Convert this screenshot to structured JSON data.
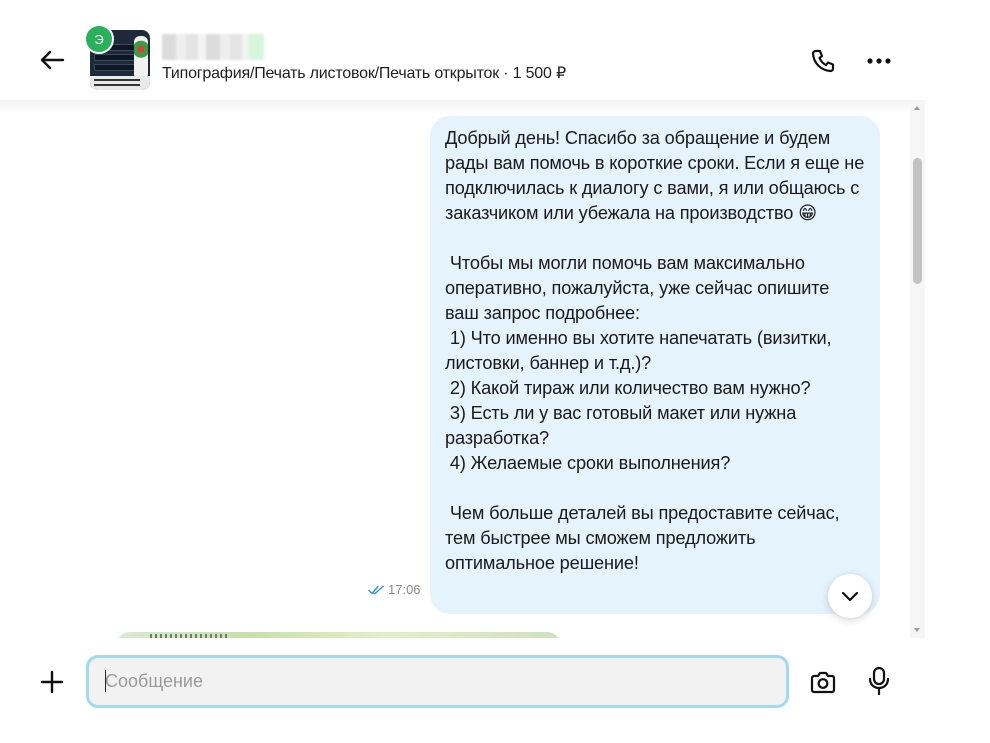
{
  "header": {
    "back_icon": "arrow-left-icon",
    "avatar_letter": "Э",
    "avatar_color": "#2ab05a",
    "listing_text": "Типография/Печать листовок/Печать открыток · 1 500 ₽",
    "call_icon": "phone-icon",
    "more_icon": "more-dots-icon"
  },
  "chat": {
    "messages": [
      {
        "direction": "outgoing",
        "text": "Добрый день! Спасибо за обращение и будем рады вам помочь в короткие сроки. Если я еще не подключилась к диалогу с вами, я или общаюсь с заказчиком или убежала на производство 😁\n\n Чтобы мы могли помочь вам максимально оперативно, пожалуйста, уже сейчас опишите ваш запрос подробнее:\n 1) Что именно вы хотите напечатать (визитки, листовки, баннер и т.д.)?\n 2) Какой тираж или количество вам нужно?\n 3) Есть ли у вас готовый макет или нужна разработка?\n 4) Желаемые сроки выполнения?\n\n Чем больше деталей вы предоставите сейчас, тем быстрее мы сможем предложить оптимальное решение!",
        "time": "17:06",
        "status_icon": "double-check-icon",
        "bubble_color": "#e5f3fc"
      }
    ],
    "scroll_down_icon": "chevron-down-icon"
  },
  "composer": {
    "add_icon": "plus-icon",
    "placeholder": "Сообщение",
    "value": "",
    "camera_icon": "camera-icon",
    "mic_icon": "microphone-icon",
    "focus_color": "#9fd9f2"
  }
}
